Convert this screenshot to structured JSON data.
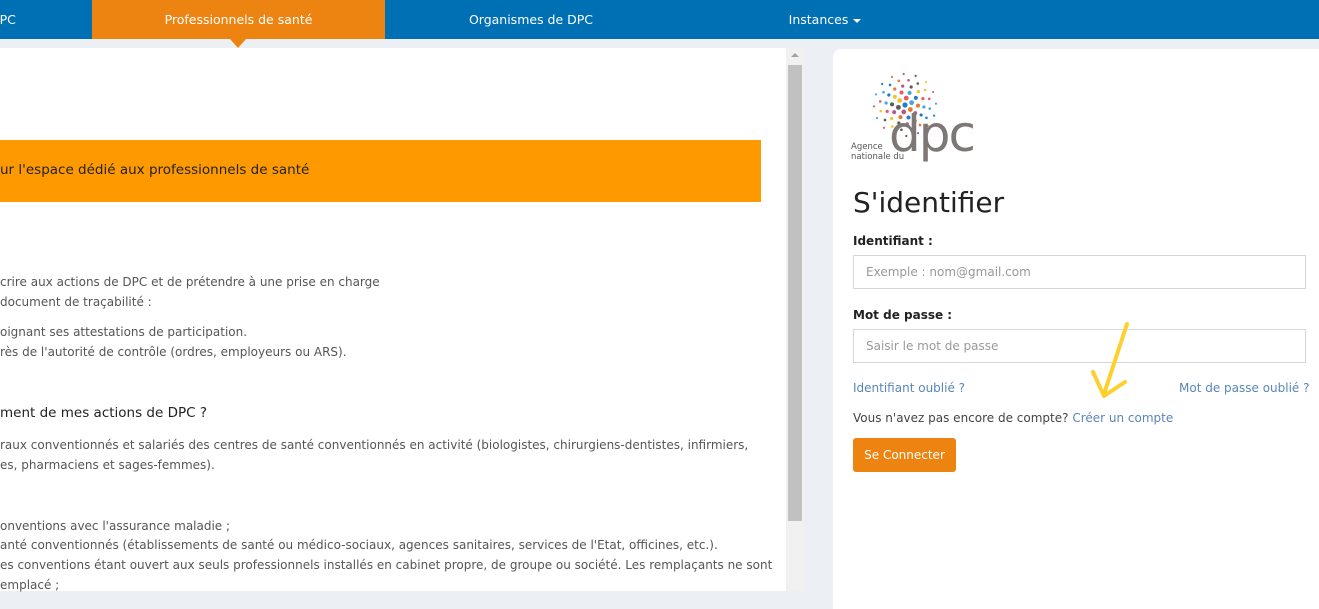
{
  "nav": {
    "items": [
      {
        "label": "DPC",
        "active": false
      },
      {
        "label": "Professionnels de santé",
        "active": true
      },
      {
        "label": "Organismes de DPC",
        "active": false
      },
      {
        "label": "Instances",
        "active": false,
        "has_dropdown": true
      }
    ],
    "colors": {
      "bar": "#0070b5",
      "active": "#ed8411"
    }
  },
  "content": {
    "banner_text": "ur l'espace dédié aux professionnels de santé",
    "paragraphs": [
      "crire aux actions de DPC et de prétendre à une prise en charge",
      " document de traçabilité :",
      "oignant ses attestations de participation.",
      "rès de l'autorité de contrôle (ordres, employeurs ou ARS)."
    ],
    "heading": "ment de mes actions de DPC ?",
    "eligibility": [
      "raux conventionnés et salariés des centres de santé conventionnés en activité (biologistes, chirurgiens-dentistes, infirmiers,",
      "es, pharmaciens et sages-femmes)."
    ],
    "conditions": [
      "onventions avec l'assurance maladie ;",
      "anté conventionnés (établissements de santé ou médico-sociaux, agences sanitaires, services de l'Etat, officines, etc.).",
      "es conventions étant ouvert aux seuls professionnels installés en cabinet propre, de groupe ou société. Les remplaçants ne sont",
      "emplacé ;"
    ],
    "banner_color": "#ff9900"
  },
  "login": {
    "logo": {
      "line1": "Agence",
      "line2": "nationale du",
      "brand": "dpc"
    },
    "title": "S'identifier",
    "identifier_label": "Identifiant :",
    "identifier_placeholder": "Exemple : nom@gmail.com",
    "identifier_value": "",
    "password_label": "Mot de passe :",
    "password_placeholder": "Saisir le mot de passe",
    "password_value": "",
    "forgot_identifier": "Identifiant oublié ?",
    "forgot_password": "Mot de passe oublié ?",
    "no_account_text": "Vous n'avez pas encore de compte?",
    "create_account": "Créer un compte",
    "submit_label": "Se Connecter",
    "link_color": "#5a86b8",
    "button_color": "#ed8411"
  },
  "annotation": {
    "icon": "arrow-down-left-icon",
    "color": "#fdd02f"
  }
}
